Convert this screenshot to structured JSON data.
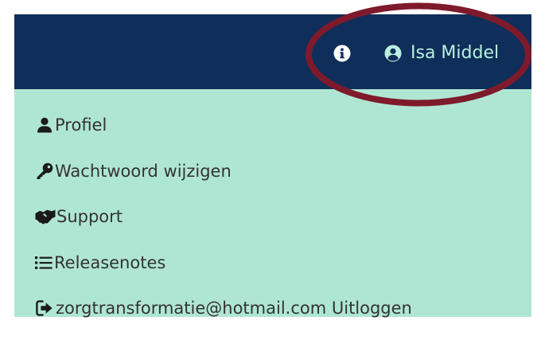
{
  "header": {
    "info_icon": "info-circle-icon",
    "user_icon": "user-circle-icon",
    "user_name": "Isa Middel"
  },
  "menu": {
    "items": [
      {
        "icon": "user-icon",
        "label": "Profiel"
      },
      {
        "icon": "key-icon",
        "label": "Wachtwoord wijzigen"
      },
      {
        "icon": "handshake-icon",
        "label": "Support"
      },
      {
        "icon": "list-icon",
        "label": "Releasenotes"
      },
      {
        "icon": "sign-out-icon",
        "label": "zorgtransformatie@hotmail.com Uitloggen"
      }
    ]
  },
  "colors": {
    "header_bg": "#0f2e5a",
    "menu_bg": "#afe6d3",
    "user_name_text": "#b9f0de",
    "menu_text": "#333333",
    "annotation_ring": "#7e1a2b"
  }
}
